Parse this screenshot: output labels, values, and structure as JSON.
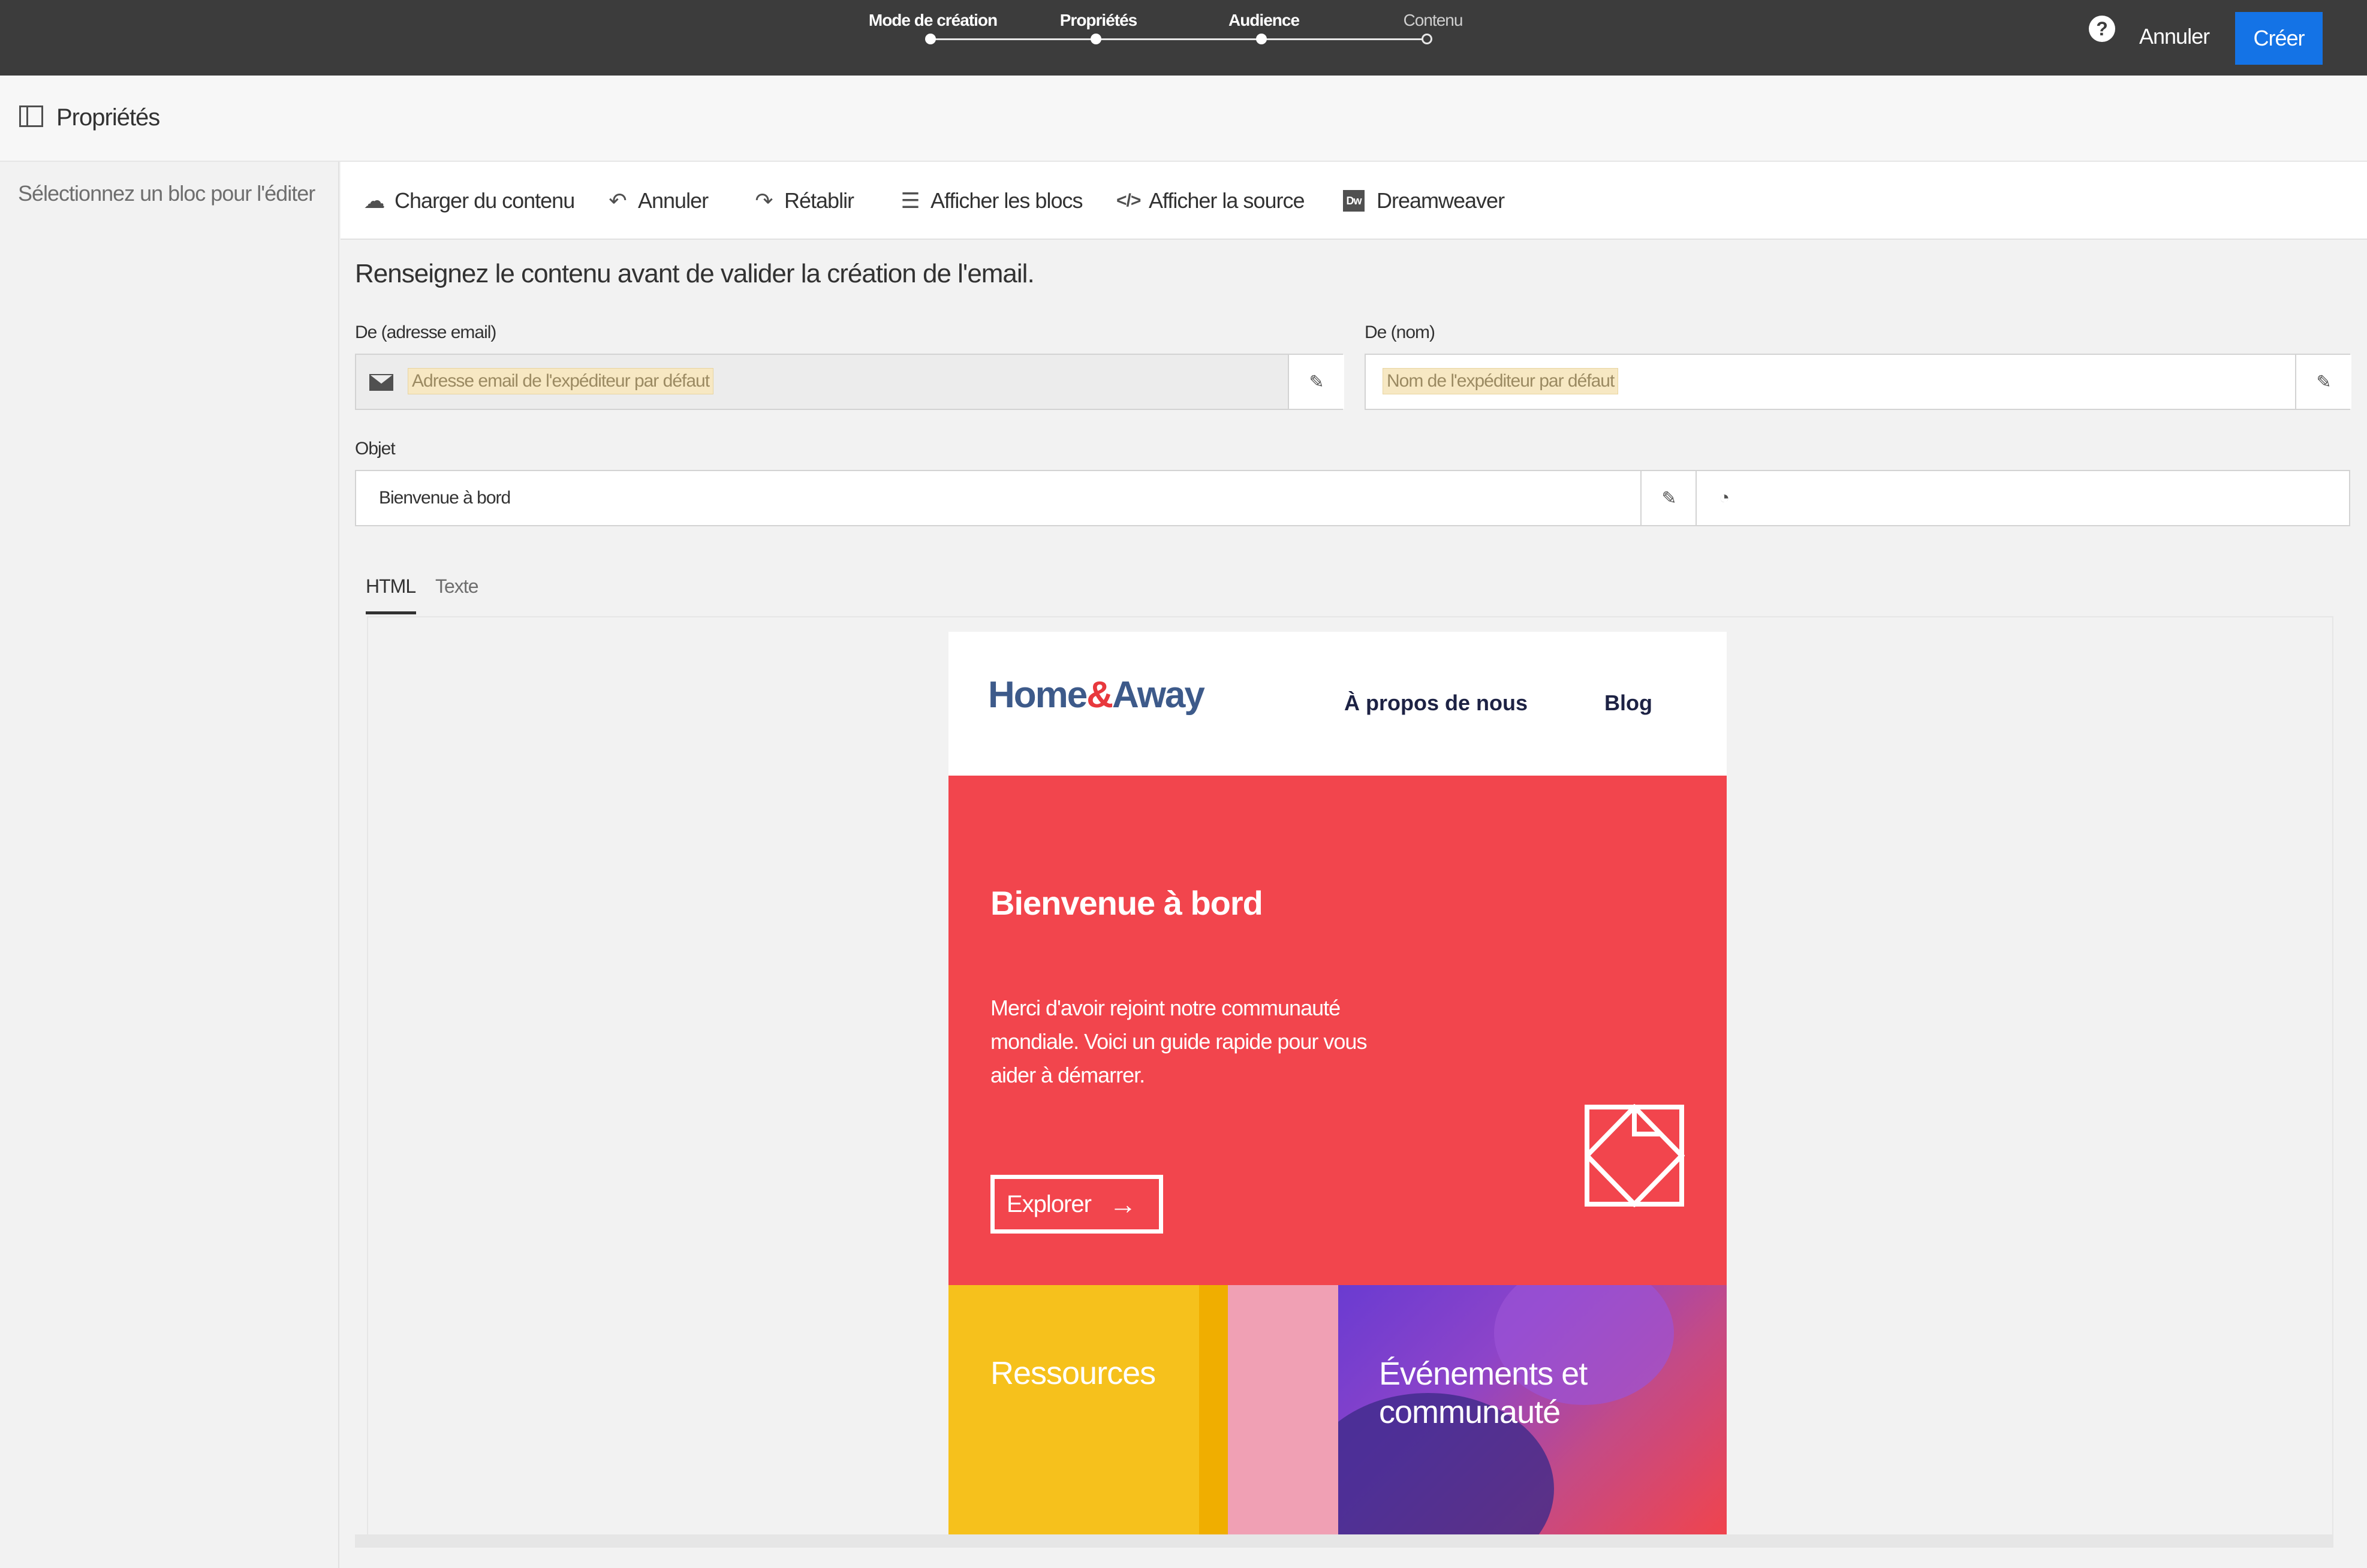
{
  "topbar": {
    "steps": [
      {
        "label": "Mode de création",
        "state": "done"
      },
      {
        "label": "Propriétés",
        "state": "done"
      },
      {
        "label": "Audience",
        "state": "done"
      },
      {
        "label": "Contenu",
        "state": "current"
      }
    ],
    "help_icon": "?",
    "cancel_label": "Annuler",
    "create_label": "Créer",
    "accent_color": "#1473e6"
  },
  "properties": {
    "title": "Propriétés",
    "hint": "Sélectionnez un bloc pour l'éditer"
  },
  "toolbar": {
    "load": "Charger du contenu",
    "undo": "Annuler",
    "redo": "Rétablir",
    "show_blocks": "Afficher les blocs",
    "show_source": "Afficher la source",
    "dreamweaver": "Dreamweaver",
    "dw_badge": "Dw"
  },
  "form": {
    "instruction": "Renseignez le contenu avant de valider la création de l'email.",
    "from_email": {
      "label": "De (adresse email)",
      "placeholder": "Adresse email de l'expéditeur par défaut"
    },
    "from_name": {
      "label": "De (nom)",
      "placeholder": "Nom de l'expéditeur par défaut"
    },
    "subject": {
      "label": "Objet",
      "value": "Bienvenue à bord"
    }
  },
  "tabs": [
    {
      "label": "HTML",
      "active": true
    },
    {
      "label": "Texte",
      "active": false
    }
  ],
  "email": {
    "logo_home": "Home",
    "logo_amp": "&",
    "logo_away": "Away",
    "nav_about": "À propos de nous",
    "nav_blog": "Blog",
    "hero_title": "Bienvenue à bord",
    "hero_text": "Merci d'avoir rejoint notre communauté mondiale. Voici un guide rapide pour vous aider à démarrer.",
    "hero_button": "Explorer",
    "hero_color": "#f2454d",
    "tile_resources": "Ressources",
    "tile_events": "Événements et communauté"
  }
}
